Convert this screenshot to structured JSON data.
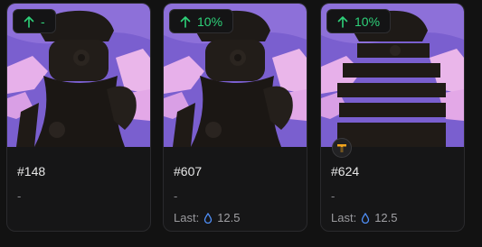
{
  "cards": [
    {
      "badge_arrow": "arrow-up-icon",
      "change": "-",
      "name": "#148",
      "price": "-",
      "has_last": false,
      "has_token_badge": false
    },
    {
      "badge_arrow": "arrow-up-icon",
      "change": "10%",
      "name": "#607",
      "price": "-",
      "has_last": true,
      "last_label": "Last:",
      "last_value": "12.5",
      "has_token_badge": false
    },
    {
      "badge_arrow": "arrow-up-icon",
      "change": "10%",
      "name": "#624",
      "price": "-",
      "has_last": true,
      "last_label": "Last:",
      "last_value": "12.5",
      "has_token_badge": true
    }
  ],
  "colors": {
    "positive": "#2ed27a",
    "drop_icon": "#4f8ff7",
    "token_badge": "#f2a41c",
    "art_sky": "#8b6cd6",
    "art_cloud": "#e6a9e8"
  }
}
